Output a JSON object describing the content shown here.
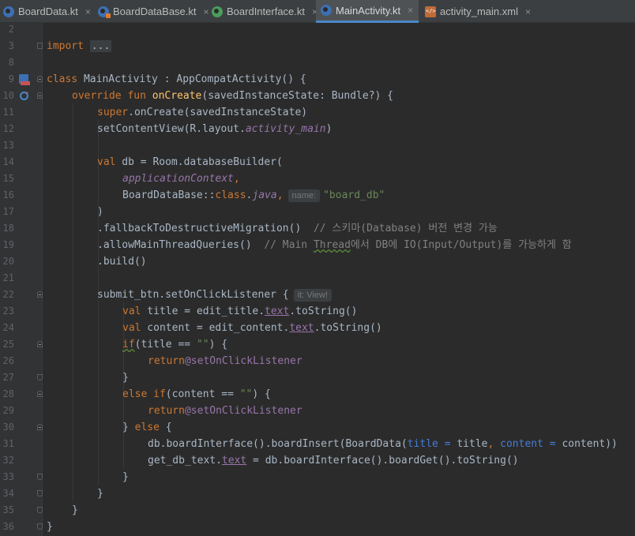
{
  "tabs": [
    {
      "label": "BoardData.kt",
      "icon": "kotlin-class-icon",
      "active": false
    },
    {
      "label": "BoardDataBase.kt",
      "icon": "kotlin-class-icon",
      "active": false
    },
    {
      "label": "BoardInterface.kt",
      "icon": "kotlin-interface-icon",
      "active": false
    },
    {
      "label": "MainActivity.kt",
      "icon": "kotlin-class-icon",
      "active": true
    },
    {
      "label": "activity_main.xml",
      "icon": "xml-file-icon",
      "active": false
    }
  ],
  "close_glyph": "×",
  "line_numbers": [
    "2",
    "3",
    "8",
    "9",
    "10",
    "11",
    "12",
    "13",
    "14",
    "15",
    "16",
    "17",
    "18",
    "19",
    "20",
    "21",
    "22",
    "23",
    "24",
    "25",
    "26",
    "27",
    "28",
    "29",
    "30",
    "31",
    "32",
    "33",
    "34",
    "35",
    "36"
  ],
  "code": {
    "l3": {
      "kw": "import",
      "ellipsis": "..."
    },
    "l9": {
      "kw": "class",
      "text": " MainActivity : AppCompatActivity() {"
    },
    "l10": {
      "kw1": "override fun",
      "fn": "onCreate",
      "text": "(savedInstanceState: Bundle?) {"
    },
    "l11": {
      "kw": "super",
      "text": ".onCreate(savedInstanceState)"
    },
    "l12": {
      "text1": "setContentView(R.layout.",
      "it": "activity_main",
      "text2": ")"
    },
    "l14": {
      "kw": "val",
      "text": " db = Room.databaseBuilder("
    },
    "l15": {
      "it": "applicationContext",
      "kw": ","
    },
    "l16": {
      "text1": "BoardDataBase::",
      "kw1": "class",
      "text2": ".",
      "it": "java",
      "kw2": ",",
      "hint": "name:",
      "str": "\"board_db\""
    },
    "l17": {
      "text": ")"
    },
    "l18": {
      "text": ".fallbackToDestructiveMigration()",
      "cmt": "// 스키마(Database) 버전 변경 가능"
    },
    "l19": {
      "text": ".allowMainThreadQueries()",
      "cmt1": "// Main ",
      "cmt2": "Thread",
      "cmt3": "에서 DB에 IO(Input/Output)를 가능하게 함"
    },
    "l20": {
      "text": ".build()"
    },
    "l22": {
      "text": "submit_btn.setOnClickListener {",
      "hint": "it: View!"
    },
    "l23": {
      "kw": "val",
      "text1": " title = edit_title.",
      "prop": "text",
      "text2": ".toString()"
    },
    "l24": {
      "kw": "val",
      "text1": " content = edit_content.",
      "prop": "text",
      "text2": ".toString()"
    },
    "l25": {
      "kw": "if",
      "text1": "(title == ",
      "str": "\"\"",
      "text2": ") {"
    },
    "l26": {
      "kw": "return",
      "lbl": "@setOnClickListener"
    },
    "l27": {
      "text": "}"
    },
    "l28": {
      "kw": "else if",
      "text1": "(content == ",
      "str": "\"\"",
      "text2": ") {"
    },
    "l29": {
      "kw": "return",
      "lbl": "@setOnClickListener"
    },
    "l30": {
      "text1": "} ",
      "kw": "else",
      "text2": " {"
    },
    "l31": {
      "text1": "db.boardInterface().boardInsert(BoardData(",
      "p1": "title = ",
      "v1": "title",
      "c1": ", ",
      "p2": "content = ",
      "v2": "content",
      "text2": "))"
    },
    "l32": {
      "text1": "get_db_text.",
      "prop": "text",
      "text2": " = db.boardInterface().boardGet().toString()"
    },
    "l33": {
      "text": "}"
    },
    "l34": {
      "text": "}"
    },
    "l35": {
      "text": "}"
    },
    "l36": {
      "text": "}"
    }
  }
}
